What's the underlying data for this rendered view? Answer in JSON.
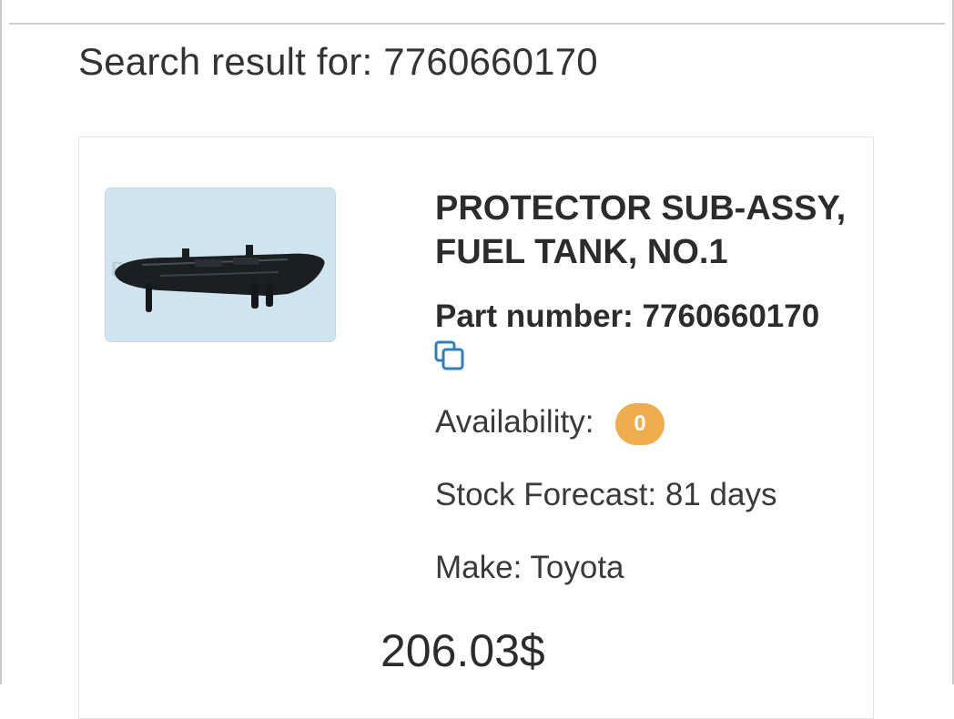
{
  "search": {
    "label": "Search result for:",
    "query": "7760660170",
    "title": "Search result for: 7760660170"
  },
  "product": {
    "name": "PROTECTOR SUB-ASSY, FUEL TANK, NO.1",
    "part_number_label": "Part number:",
    "part_number": "7760660170",
    "copy_icon": "copy-icon",
    "availability_label": "Availability:",
    "availability_count": "0",
    "stock_forecast": "Stock Forecast: 81 days",
    "make": "Make: Toyota",
    "price": "206.03$"
  },
  "colors": {
    "badge": "#f0ad4e",
    "copy_icon": "#2f7fb8",
    "text": "#2c2c2c"
  }
}
